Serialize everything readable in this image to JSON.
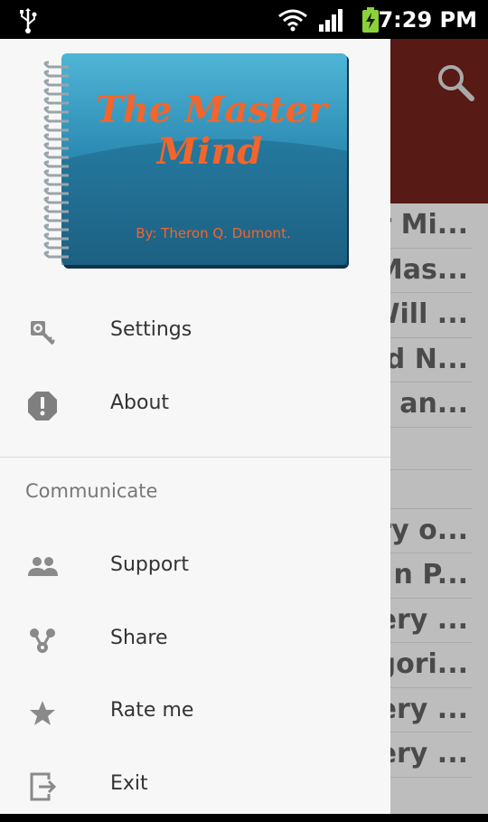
{
  "status_bar": {
    "time": "7:29 PM",
    "icons": [
      "usb-icon",
      "wifi-icon",
      "signal-icon",
      "battery-charging-icon"
    ]
  },
  "book_cover": {
    "title_line1": "The Master",
    "title_line2": "Mind",
    "author": "By: Theron Q. Dumont."
  },
  "drawer": {
    "items_top": [
      {
        "label": "Settings",
        "icon": "settings-key-icon"
      },
      {
        "label": "About",
        "icon": "info-alert-icon"
      }
    ],
    "section_header": "Communicate",
    "items_communicate": [
      {
        "label": "Support",
        "icon": "people-icon"
      },
      {
        "label": "Share",
        "icon": "share-icon"
      },
      {
        "label": "Rate me",
        "icon": "star-icon"
      },
      {
        "label": "Exit",
        "icon": "exit-icon"
      }
    ]
  },
  "background_list": {
    "rows": [
      "r Mi...",
      "Mas...",
      "Will ...",
      "d N...",
      "an...",
      "",
      "",
      "ry o...",
      "n P...",
      "ery ...",
      "gori...",
      "ery ...",
      "ery ..."
    ]
  },
  "colors": {
    "actionbar": "#571a14",
    "cover_title": "#f2652b",
    "cover_bg": "#2f8ab0"
  }
}
